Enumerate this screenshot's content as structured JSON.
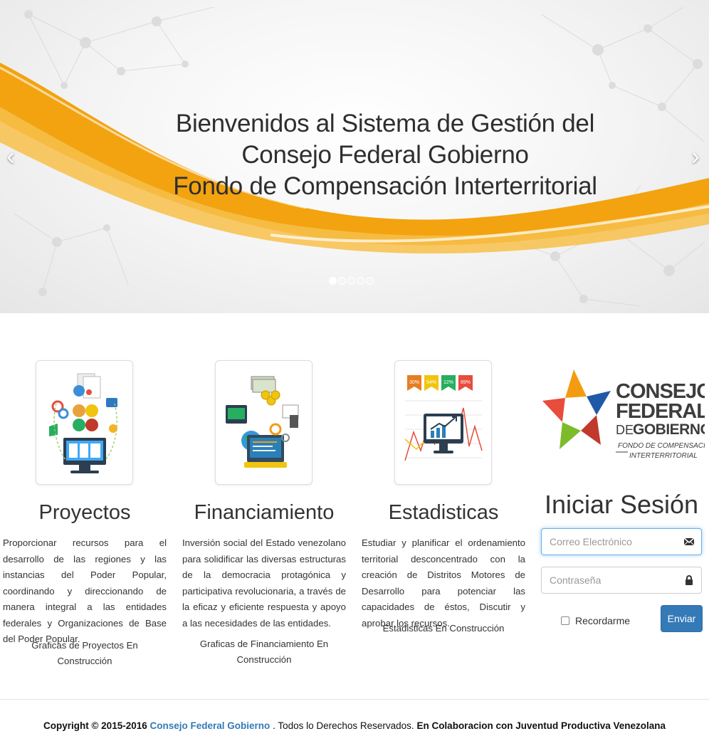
{
  "hero": {
    "title_lines": [
      "Bienvenidos al Sistema de Gestión del",
      "Consejo Federal Gobierno",
      "Fondo de Compensación Interterritorial"
    ],
    "slide_count": 5,
    "active_slide": 1,
    "accent_color": "#f2a30f"
  },
  "features": [
    {
      "title": "Proyectos",
      "icon": "projects-illustration",
      "description": "Proporcionar recursos para el desarrollo de las regiones y las instancias del Poder Popular, coordinando y direccionando de manera integral a las entidades federales y Organizaciones de Base del Poder Popular.",
      "note": "Graficas de Proyectos En Construcción"
    },
    {
      "title": "Financiamiento",
      "icon": "financing-illustration",
      "description": "Inversión social del Estado venezolano para solidificar las diversas estructuras de la democracia protagónica y participativa revolucionaria, a través de la eficaz y eficiente respuesta y apoyo a las necesidades de las entidades.",
      "note": "Graficas de Financiamiento En Construcción"
    },
    {
      "title": "Estadisticas",
      "icon": "statistics-illustration",
      "description": "Estudiar y planificar el ordenamiento territorial desconcentrado con la creación de Distritos Motores de Desarrollo para potenciar las capacidades de éstos, Discutir y aprobar los recursos.",
      "note": "Estadisticas En Construcción",
      "badges": [
        "30%",
        "54%",
        "12%",
        "89%"
      ]
    }
  ],
  "logo": {
    "line1": "CONSEJO",
    "line2": "FEDERAL",
    "line3_prefix": "DE",
    "line3_main": "GOBIERNO",
    "tagline1": "FONDO DE COMPENSACIÓN",
    "tagline2": "INTERTERRITORIAL"
  },
  "login": {
    "title": "Iniciar Sesión",
    "email_placeholder": "Correo Electrónico",
    "password_placeholder": "Contraseña",
    "remember_label": "Recordarme",
    "submit_label": "Enviar"
  },
  "footer": {
    "copyright": "Copyright © 2015-2016",
    "org_link": "Consejo Federal Gobierno",
    "rights": ". Todos lo Derechos Reservados.",
    "collab": "En Colaboracion con Juventud Productiva Venezolana"
  }
}
